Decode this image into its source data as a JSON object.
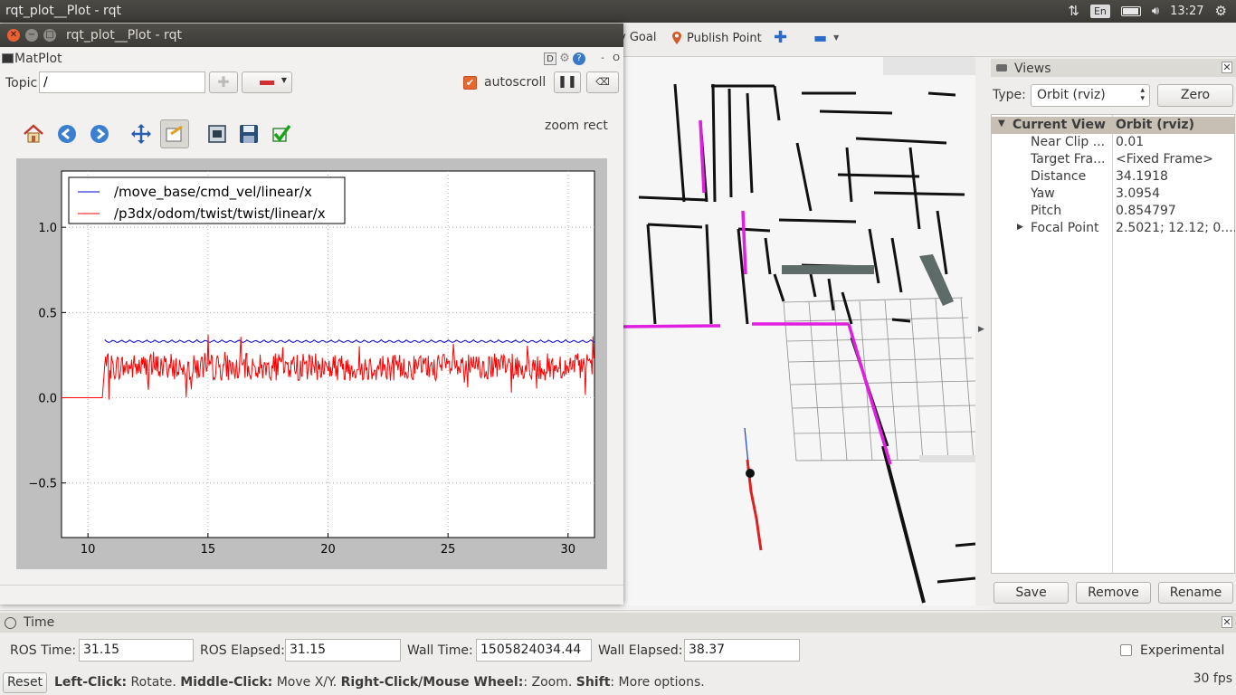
{
  "topbar": {
    "title": "rqt_plot__Plot - rqt",
    "keyboard": "En",
    "clock": "13:27"
  },
  "rviz_toolbar": {
    "goal_label": "y Goal",
    "publish_point": "Publish Point"
  },
  "views": {
    "title": "Views",
    "type_label": "Type:",
    "type_value": "Orbit (rviz)",
    "zero_button": "Zero",
    "header_key": "Current View",
    "header_value": "Orbit (rviz)",
    "rows": [
      {
        "key": "Near Clip ...",
        "value": "0.01"
      },
      {
        "key": "Target Fra...",
        "value": "<Fixed Frame>"
      },
      {
        "key": "Distance",
        "value": "34.1918"
      },
      {
        "key": "Yaw",
        "value": "3.0954"
      },
      {
        "key": "Pitch",
        "value": "0.854797"
      },
      {
        "key": "Focal Point",
        "value": "2.5021; 12.12; 0...."
      }
    ],
    "save_button": "Save",
    "remove_button": "Remove",
    "rename_button": "Rename"
  },
  "time": {
    "title": "Time",
    "ros_time_label": "ROS Time:",
    "ros_time": "31.15",
    "ros_elapsed_label": "ROS Elapsed:",
    "ros_elapsed": "31.15",
    "wall_time_label": "Wall Time:",
    "wall_time": "1505824034.44",
    "wall_elapsed_label": "Wall Elapsed:",
    "wall_elapsed": "38.37",
    "experimental_label": "Experimental"
  },
  "statusbar": {
    "reset_button": "Reset",
    "hint_b1": "Left-Click:",
    "hint_t1": " Rotate. ",
    "hint_b2": "Middle-Click:",
    "hint_t2": " Move X/Y. ",
    "hint_b3": "Right-Click/Mouse Wheel:",
    "hint_t3": ": Zoom. ",
    "hint_b4": "Shift",
    "hint_t4": ": More options.",
    "fps": "30 fps"
  },
  "rqt": {
    "window_title": "rqt_plot__Plot - rqt",
    "plugin_title": "MatPlot",
    "plugin_buttons": [
      "D",
      "?",
      "-",
      "O"
    ],
    "topic_label": "Topic",
    "topic_value": "/",
    "autoscroll_label": "autoscroll",
    "zoom_mode": "zoom rect"
  },
  "colors": {
    "series_blue": "#0000cc",
    "series_red": "#ff0000",
    "map_magenta": "#e01fe0"
  },
  "chart_data": {
    "type": "line",
    "title": "",
    "xlabel": "",
    "ylabel": "",
    "xlim": [
      8.9,
      31.1
    ],
    "ylim": [
      -0.82,
      1.33
    ],
    "xticks": [
      10,
      15,
      20,
      25,
      30
    ],
    "xtick_labels": [
      "10",
      "15",
      "20",
      "25",
      "30"
    ],
    "yticks": [
      -0.5,
      0.0,
      0.5,
      1.0
    ],
    "ytick_labels": [
      "−0.5",
      "0.0",
      "0.5",
      "1.0"
    ],
    "grid": true,
    "legend_position": "top-left",
    "series": [
      {
        "name": "/move_base/cmd_vel/linear/x",
        "color": "#0000cc",
        "x": [
          10.7,
          31.1
        ],
        "y": [
          0.34,
          0.34
        ],
        "ripple": 0.015
      },
      {
        "name": "/p3dx/odom/twist/twist/linear/x",
        "color": "#ff0000",
        "x": [
          8.9,
          10.6,
          10.7,
          31.1
        ],
        "y": [
          0.0,
          0.0,
          0.18,
          0.18
        ],
        "noise_amplitude": 0.08
      }
    ]
  }
}
